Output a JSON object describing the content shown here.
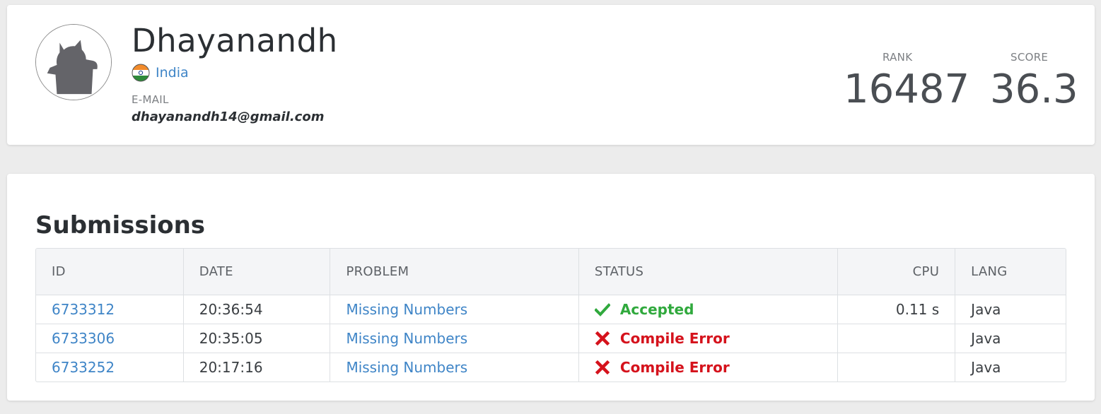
{
  "profile": {
    "name": "Dhayanandh",
    "country": "India",
    "email_label": "E-MAIL",
    "email": "dhayanandh14@gmail.com",
    "rank_label": "RANK",
    "rank": "16487",
    "score_label": "SCORE",
    "score": "36.3"
  },
  "submissions": {
    "title": "Submissions",
    "columns": [
      "ID",
      "DATE",
      "PROBLEM",
      "STATUS",
      "CPU",
      "LANG"
    ],
    "rows": [
      {
        "id": "6733312",
        "date": "20:36:54",
        "problem": "Missing Numbers",
        "status": "Accepted",
        "status_type": "ok",
        "cpu": "0.11 s",
        "lang": "Java"
      },
      {
        "id": "6733306",
        "date": "20:35:05",
        "problem": "Missing Numbers",
        "status": "Compile Error",
        "status_type": "err",
        "cpu": "",
        "lang": "Java"
      },
      {
        "id": "6733252",
        "date": "20:17:16",
        "problem": "Missing Numbers",
        "status": "Compile Error",
        "status_type": "err",
        "cpu": "",
        "lang": "Java"
      }
    ]
  },
  "colors": {
    "link": "#3f85c7",
    "accepted": "#30a93d",
    "error": "#d5121c"
  },
  "icons": {
    "accepted": "checkmark-icon",
    "error": "cross-icon",
    "flag": "india-flag-icon"
  }
}
